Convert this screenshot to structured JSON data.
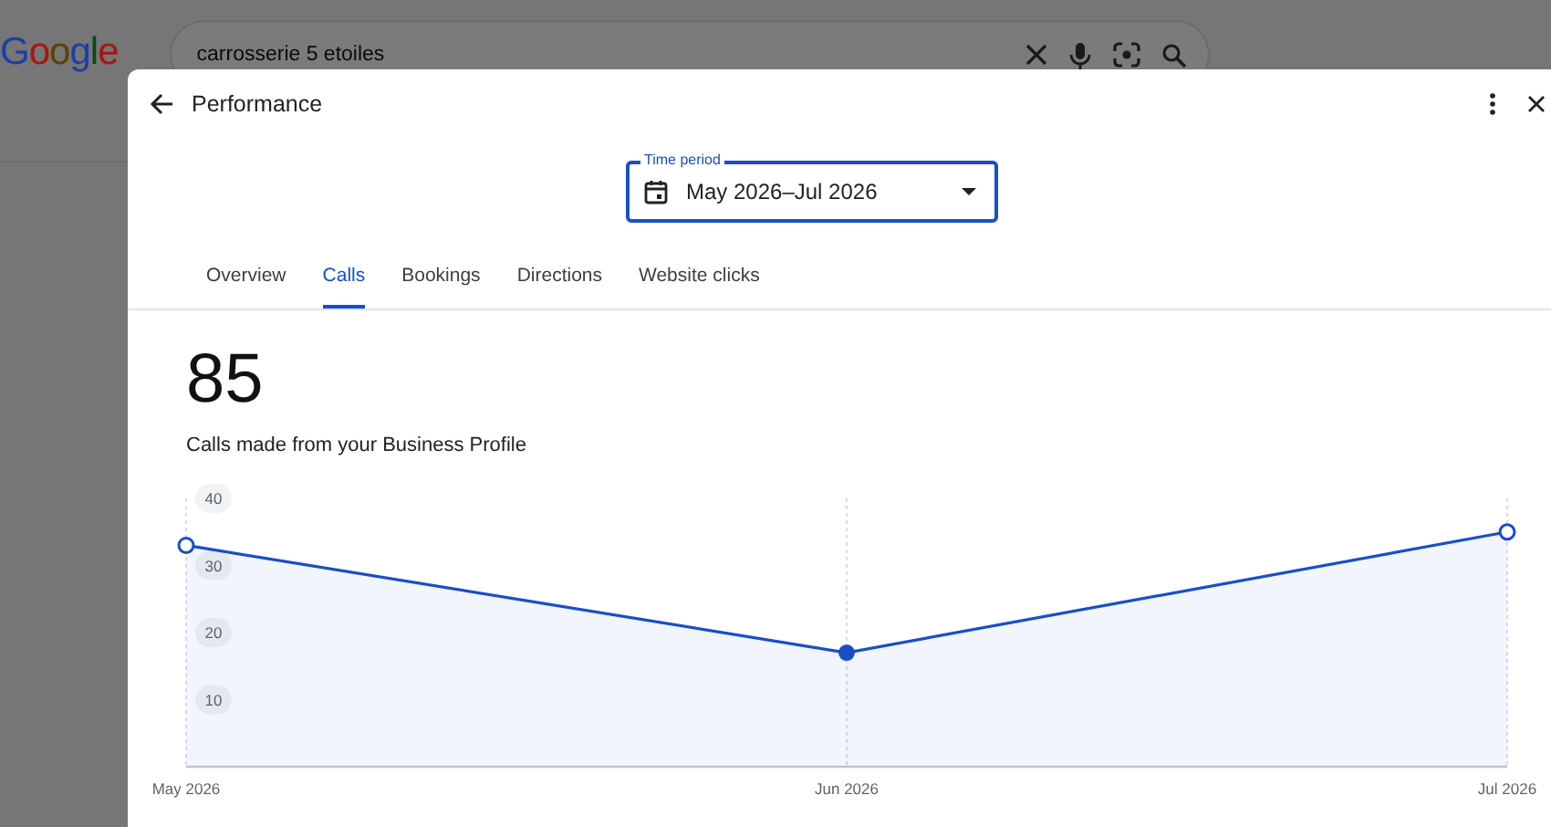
{
  "page": {
    "logo": "Google",
    "search": {
      "value": "carrosserie 5 etoiles"
    }
  },
  "dialog": {
    "title": "Performance",
    "time_period": {
      "label": "Time period",
      "value": "May 2026–Jul 2026"
    },
    "tabs": [
      {
        "label": "Overview",
        "selected": false
      },
      {
        "label": "Calls",
        "selected": true
      },
      {
        "label": "Bookings",
        "selected": false
      },
      {
        "label": "Directions",
        "selected": false
      },
      {
        "label": "Website clicks",
        "selected": false
      }
    ],
    "metric": {
      "value": "85",
      "caption": "Calls made from your Business Profile"
    },
    "chart_data": {
      "type": "area",
      "categories": [
        "May 2026",
        "Jun 2026",
        "Jul 2026"
      ],
      "series": [
        {
          "color": "#1a4fc4",
          "values": [
            33,
            17,
            35
          ]
        }
      ],
      "ylim": [
        0,
        40
      ],
      "yticks": [
        10,
        20,
        30,
        40
      ]
    }
  }
}
